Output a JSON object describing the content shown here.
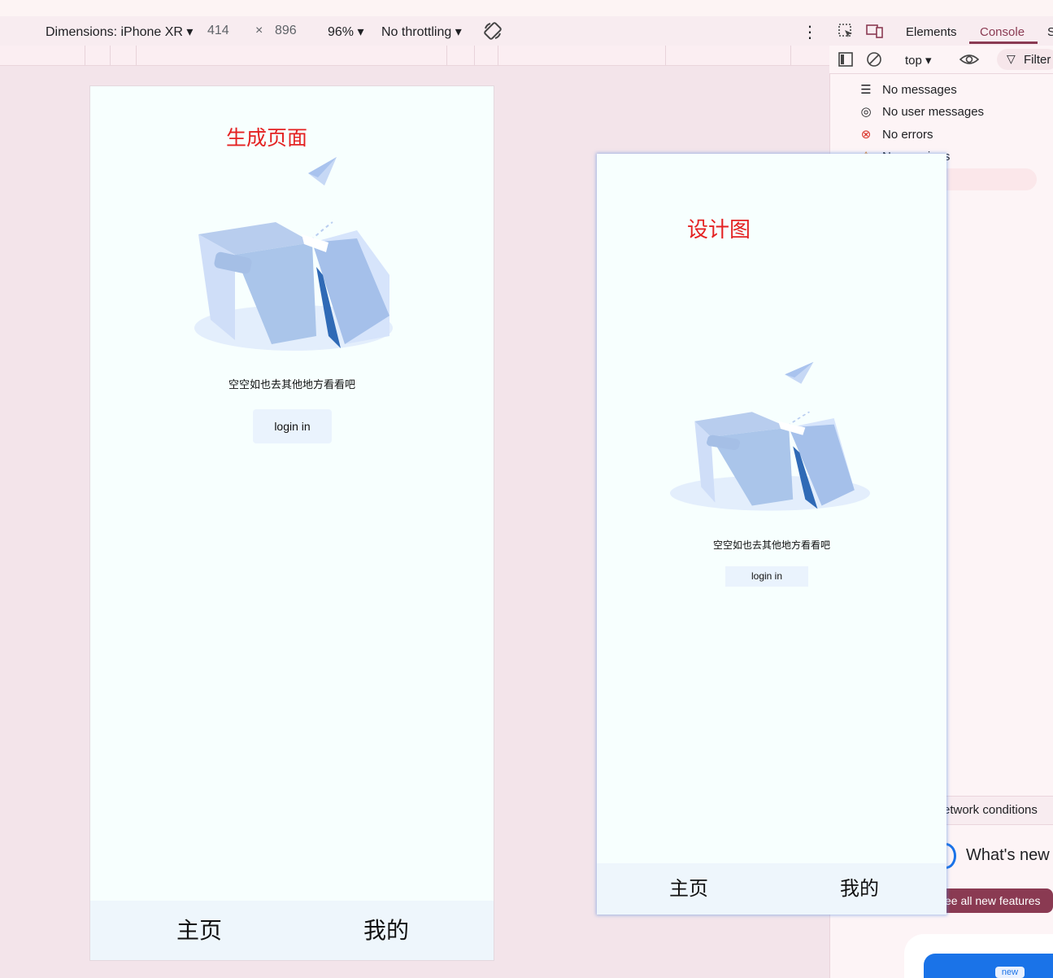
{
  "toolbar": {
    "device": "Dimensions: iPhone XR ▾",
    "width": "414",
    "times": "×",
    "height": "896",
    "zoom": "96% ▾",
    "throttle": "No throttling ▾"
  },
  "phone_left": {
    "caption": "生成页面",
    "empty_text": "空空如也去其他地方看看吧",
    "login_label": "login in",
    "tabs": [
      "主页",
      "我的"
    ]
  },
  "phone_right": {
    "caption": "设计图",
    "empty_text": "空空如也去其他地方看看吧",
    "login_label": "login in",
    "tabs": [
      "主页",
      "我的"
    ]
  },
  "devtools": {
    "tabs": {
      "elements": "Elements",
      "console": "Console",
      "sources": "S"
    },
    "context": "top ▾",
    "filter": "Filter",
    "sidebar": [
      {
        "label": "No messages",
        "icon": "list-icon"
      },
      {
        "label": "No user messages",
        "icon": "user-icon"
      },
      {
        "label": "No errors",
        "icon": "error-icon"
      },
      {
        "label": "No warnings",
        "icon": "warning-icon"
      }
    ],
    "network_conditions": "etwork conditions",
    "whats_new": "What's new",
    "see_features": "ee all new features",
    "new_badge": "new"
  },
  "colors": {
    "caption": "#e42222",
    "page_bg": "#f7fffe",
    "tabbar_bg": "#eef6fc",
    "accent": "#8a3a52"
  }
}
